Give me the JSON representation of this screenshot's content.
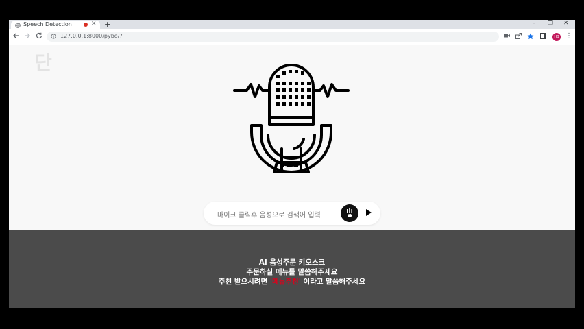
{
  "browser": {
    "tab_title": "Speech Detection",
    "tab_close": "✕",
    "new_tab": "+",
    "url": "127.0.0.1:8000/pybo/?",
    "avatar_text": "HB",
    "window_controls": {
      "minimize": "–",
      "restore": "❐",
      "close": "✕"
    }
  },
  "page": {
    "logo_text": "단",
    "search": {
      "placeholder": "마이크 클릭후 음성으로 검색어 입력"
    },
    "footer": {
      "line1": "AI 음성주문 키오스크",
      "line2": "주문하실 메뉴를 말씀해주세요",
      "line3_prefix": "추천 받으시려면 ",
      "line3_highlight": "'메뉴추천'",
      "line3_suffix": " 이라고 말씀해주세요"
    }
  },
  "icons": {
    "back": "arrow-left-icon",
    "forward": "arrow-right-icon",
    "reload": "reload-icon",
    "mic_illustration": "microphone-icon",
    "mic_button": "microphone-icon",
    "play": "play-icon"
  },
  "colors": {
    "footer_bg": "#4b4b4b",
    "highlight": "#e0001b",
    "page_bg": "#f8f8f8"
  }
}
